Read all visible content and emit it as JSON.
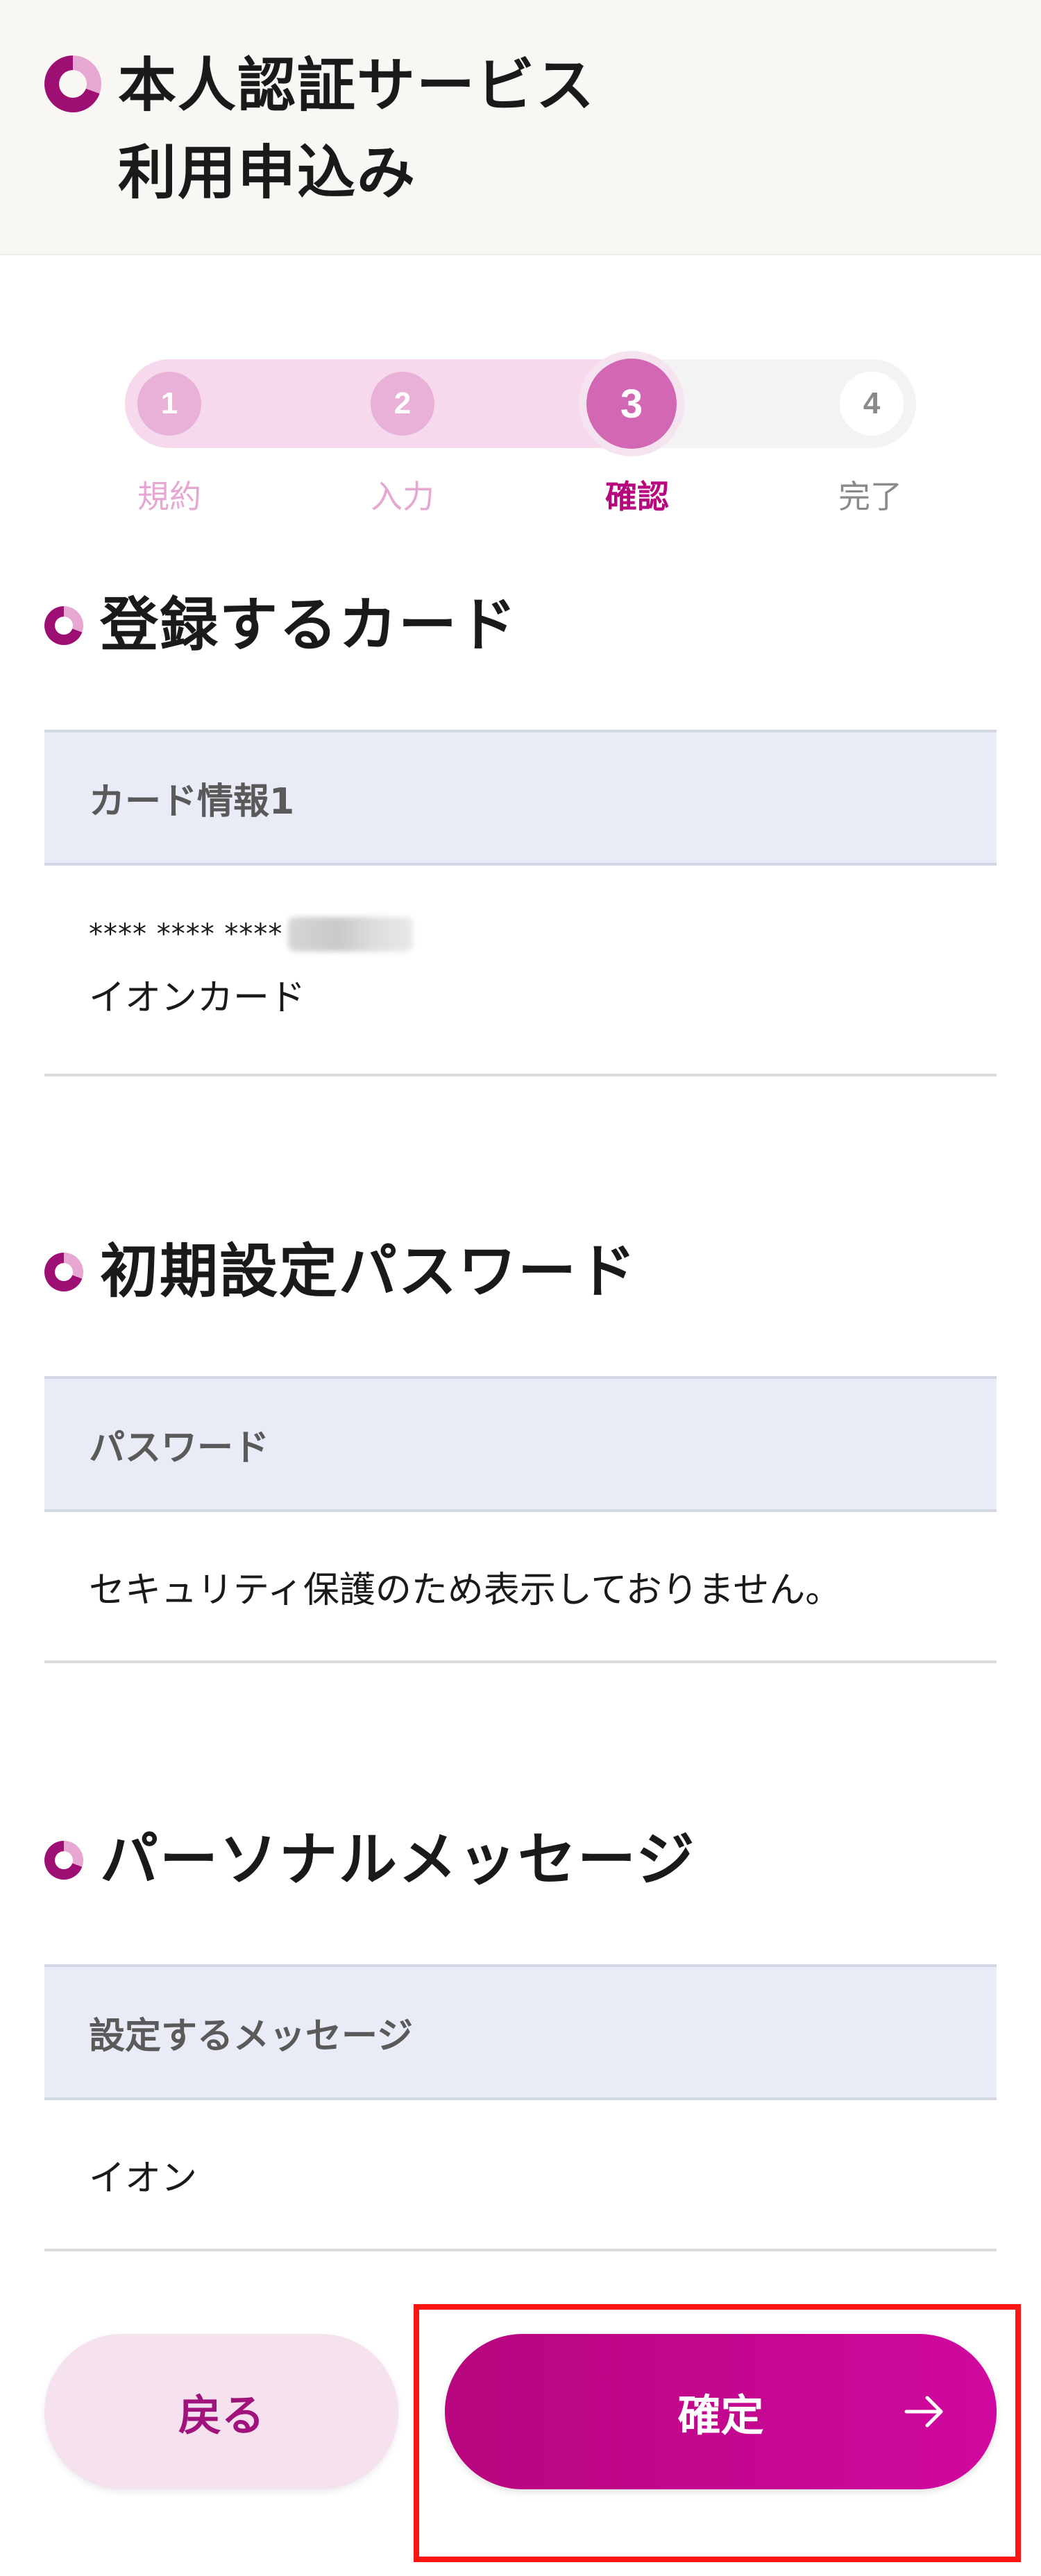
{
  "header": {
    "title_line1": "本人認証サービス",
    "title_line2": "利用申込み"
  },
  "stepper": {
    "steps": [
      {
        "num": "1",
        "label": "規約",
        "state": "done"
      },
      {
        "num": "2",
        "label": "入力",
        "state": "done"
      },
      {
        "num": "3",
        "label": "確認",
        "state": "current"
      },
      {
        "num": "4",
        "label": "完了",
        "state": "todo"
      }
    ]
  },
  "sections": {
    "card": {
      "title": "登録するカード",
      "header": "カード情報1",
      "masked_number": "**** **** ****",
      "card_name": "イオンカード"
    },
    "password": {
      "title": "初期設定パスワード",
      "header": "パスワード",
      "value": "セキュリティ保護のため表示しておりません。"
    },
    "message": {
      "title": "パーソナルメッセージ",
      "header": "設定するメッセージ",
      "value": "イオン"
    }
  },
  "buttons": {
    "back": "戻る",
    "confirm": "確定"
  },
  "colors": {
    "brand": "#b7067e",
    "brand_light": "#f6e1ef",
    "table_header": "#e9ecf6",
    "highlight": "#ff1414"
  }
}
